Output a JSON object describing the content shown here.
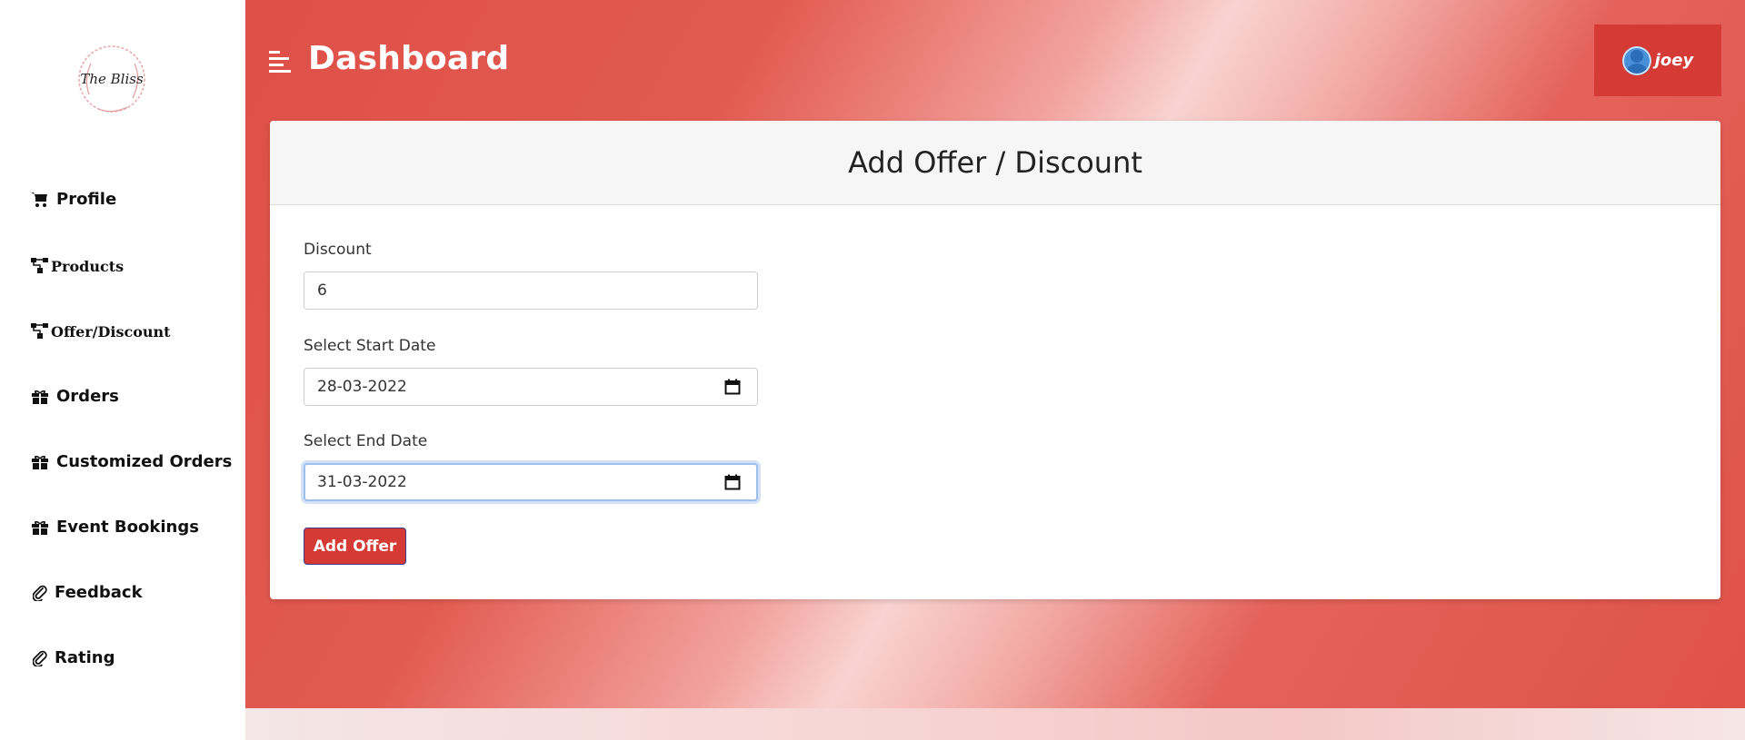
{
  "sidebar": {
    "logo_text": "The Bliss",
    "items": [
      {
        "label": "Profile",
        "icon": "cart-icon"
      },
      {
        "label": "Products",
        "icon": "sitemap-icon"
      },
      {
        "label": "Offer/Discount",
        "icon": "sitemap-icon"
      },
      {
        "label": "Orders",
        "icon": "gift-icon"
      },
      {
        "label": "Customized Orders",
        "icon": "gift-icon"
      },
      {
        "label": "Event Bookings",
        "icon": "gift-icon"
      },
      {
        "label": "Feedback",
        "icon": "paperclip-icon"
      },
      {
        "label": "Rating",
        "icon": "paperclip-icon"
      }
    ]
  },
  "header": {
    "title": "Dashboard",
    "user": {
      "name": "joey",
      "icon": "user-avatar-icon"
    }
  },
  "form": {
    "title": "Add Offer / Discount",
    "discount_label": "Discount",
    "discount_value": "6",
    "start_label": "Select Start Date",
    "start_value": "28-03-2022",
    "end_label": "Select End Date",
    "end_value": "31-03-2022",
    "submit_label": "Add Offer"
  },
  "colors": {
    "accent": "#d63a35",
    "background_gradient": [
      "#de5048",
      "#f8d3d1",
      "#df524a"
    ]
  }
}
